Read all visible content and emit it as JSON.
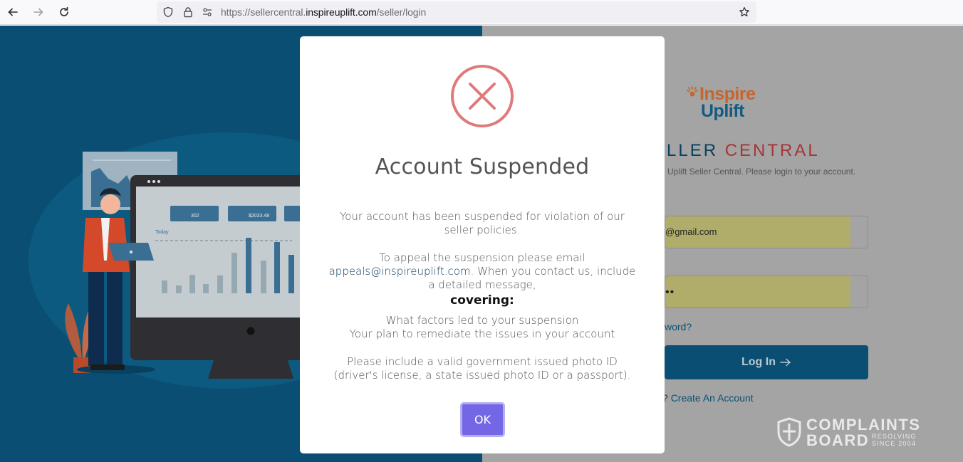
{
  "browser": {
    "url_prefix": "https://sellercentral.",
    "url_host": "inspireuplift.com",
    "url_path": "/seller/login",
    "icons": [
      "back-arrow-icon",
      "forward-arrow-icon",
      "reload-icon",
      "shield-icon",
      "lock-icon",
      "permissions-icon",
      "star-icon"
    ]
  },
  "dashboard_illustration": {
    "stat_1": "302",
    "stat_2": "$2033.48",
    "today_label": "Today"
  },
  "login": {
    "logo_top": "Inspire",
    "logo_bottom": "Uplift",
    "title_part_a": "LLER",
    "title_part_b": "CENTRAL",
    "welcome": "Uplift Seller Central. Please login to your account.",
    "email_value": "@gmail.com",
    "password_dots": "••",
    "forgot_link": "word?",
    "login_button": "Log In",
    "create_prefix": "?",
    "create_link": "Create An Account"
  },
  "modal": {
    "title": "Account Suspended",
    "p1": "Your account has been suspended for violation of our seller policies.",
    "p2_pre": "To appeal the suspension please email",
    "p2_email": "appeals@inspireuplift.com",
    "p2_post": ". When you contact us, include a detailed message,",
    "covering": "covering:",
    "item1": "What factors led to your suspension",
    "item2": "Your plan to remediate the issues in your account",
    "p3": "Please include a valid government issued photo ID (driver's license, a state issued photo ID or a passport).",
    "ok_label": "OK",
    "colors": {
      "error": "#e07a7a",
      "ok_button": "#7367e5"
    }
  },
  "watermark": {
    "line1": "COMPLAINTS",
    "line2": "BOARD",
    "tag1": "RESOLVING",
    "tag2": "SINCE 2004"
  }
}
